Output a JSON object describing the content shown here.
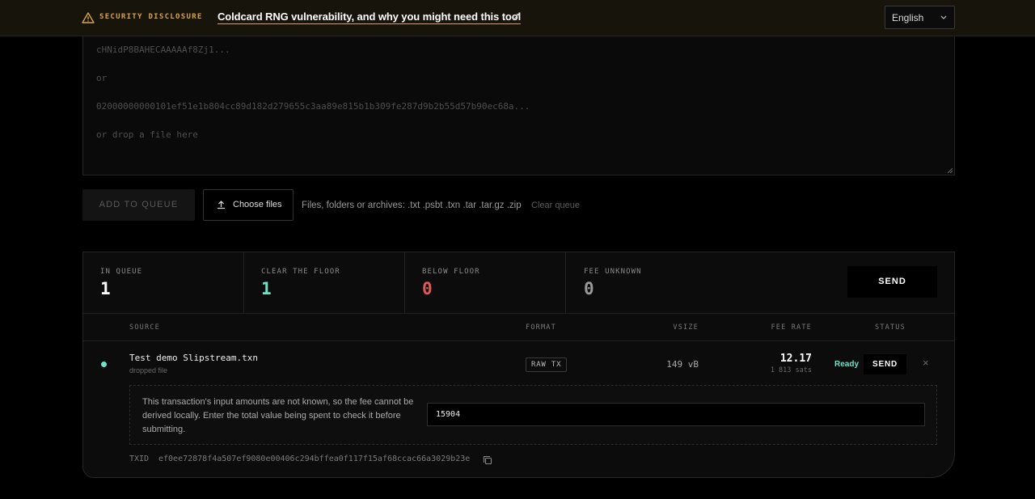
{
  "banner": {
    "tag": "SECURITY DISCLOSURE",
    "link": "Coldcard RNG vulnerability, and why you might need this tool",
    "ext_glyph": "↗",
    "warn_icon": "warning-triangle-icon",
    "accent": "#d9a441"
  },
  "language": {
    "selected": "English"
  },
  "paste": {
    "lines": [
      "cHNidP8BAHECAAAAAf8Zj1...",
      "or",
      "02000000000101ef51e1b804cc89d182d279655c3aa89e815b1b309fe287d9b2b55d57b90ec68a...",
      "or drop a file here"
    ]
  },
  "actions": {
    "add_to_queue": "ADD TO QUEUE",
    "choose_files": "Choose files",
    "hint": "Files, folders or archives: .txt .psbt .txn .tar .tar.gz .zip",
    "clear_queue": "Clear queue"
  },
  "stats": [
    {
      "label": "IN QUEUE",
      "value": "1",
      "color": "#ffffff"
    },
    {
      "label": "CLEAR THE FLOOR",
      "value": "1",
      "color": "#6fe3c6"
    },
    {
      "label": "BELOW FLOOR",
      "value": "0",
      "color": "#e05a5a"
    },
    {
      "label": "FEE UNKNOWN",
      "value": "0",
      "color": "#9a9a9a"
    }
  ],
  "send_all": "SEND",
  "table": {
    "headers": {
      "source": "SOURCE",
      "format": "FORMAT",
      "vsize": "VSIZE",
      "fee_rate": "FEE RATE",
      "status": "STATUS"
    },
    "rows": [
      {
        "name": "Test demo Slipstream.txn",
        "sub": "dropped file",
        "format": "RAW TX",
        "vsize": "149 vB",
        "fee_rate": "12.17",
        "sats": "1 813 sats",
        "status": "Ready",
        "send": "SEND",
        "remove": "×",
        "notice": "This transaction's input amounts are not known, so the fee cannot be derived locally. Enter the total value being spent to check it before submitting.",
        "input_value": "15904",
        "txid_label": "TXID",
        "txid": "ef0ee72878f4a507ef9080e00406c294bffea0f117f15af68ccac66a3029b23e"
      }
    ]
  }
}
